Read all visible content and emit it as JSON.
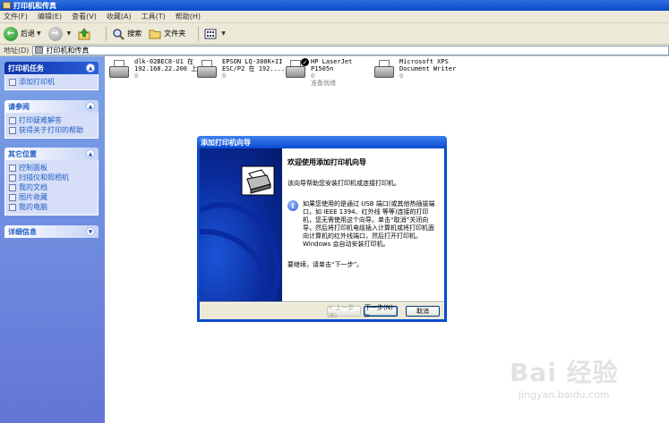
{
  "window": {
    "title": "打印机和传真"
  },
  "menu": [
    "文件(F)",
    "编辑(E)",
    "查看(V)",
    "收藏(A)",
    "工具(T)",
    "帮助(H)"
  ],
  "toolbar": {
    "back": "后退",
    "search": "搜索",
    "folders": "文件夹"
  },
  "address": {
    "label": "地址(D)",
    "value": "打印机和传真"
  },
  "sidebar": {
    "printer_tasks": {
      "title": "打印机任务",
      "items": [
        "添加打印机"
      ]
    },
    "see_also": {
      "title": "请参阅",
      "items": [
        "打印疑难解答",
        "获得关于打印的帮助"
      ]
    },
    "other_places": {
      "title": "其它位置",
      "items": [
        "控制面板",
        "扫描仪和照相机",
        "我的文档",
        "图片收藏",
        "我的电脑"
      ]
    },
    "details": {
      "title": "详细信息"
    }
  },
  "printers": [
    {
      "name": "dlk-02BEC8-U1 在 192.168.22.200 上",
      "sub": "0"
    },
    {
      "name": "EPSON LQ-300K+II ESC/P2 在 192....",
      "sub": "0"
    },
    {
      "name": "HP LaserJet P1505n",
      "sub": "0",
      "status": "准备就绪"
    },
    {
      "name": "Microsoft XPS Document Writer",
      "sub": "0"
    }
  ],
  "wizard": {
    "title": "添加打印机向导",
    "heading": "欢迎使用添加打印机向导",
    "intro": "该向导帮助您安装打印机或连接打印机。",
    "info": "如果您使用的是通过 USB 端口(或其他热插拔端口，如 IEEE 1394、红外线 等等)连接的打印机，您无需使用这个向导。单击“取消”关闭向导，然后将打印机电缆插入计算机或将打印机面向计算机的红外线端口，然后打开打印机。Windows 会自动安装打印机。",
    "continue": "要继续，请单击“下一步”。",
    "buttons": {
      "back": "< 上一步(B)",
      "next": "下一步(N) >",
      "cancel": "取消"
    }
  },
  "watermark": {
    "brand": "Bai 经验",
    "url": "jingyan.baidu.com"
  }
}
